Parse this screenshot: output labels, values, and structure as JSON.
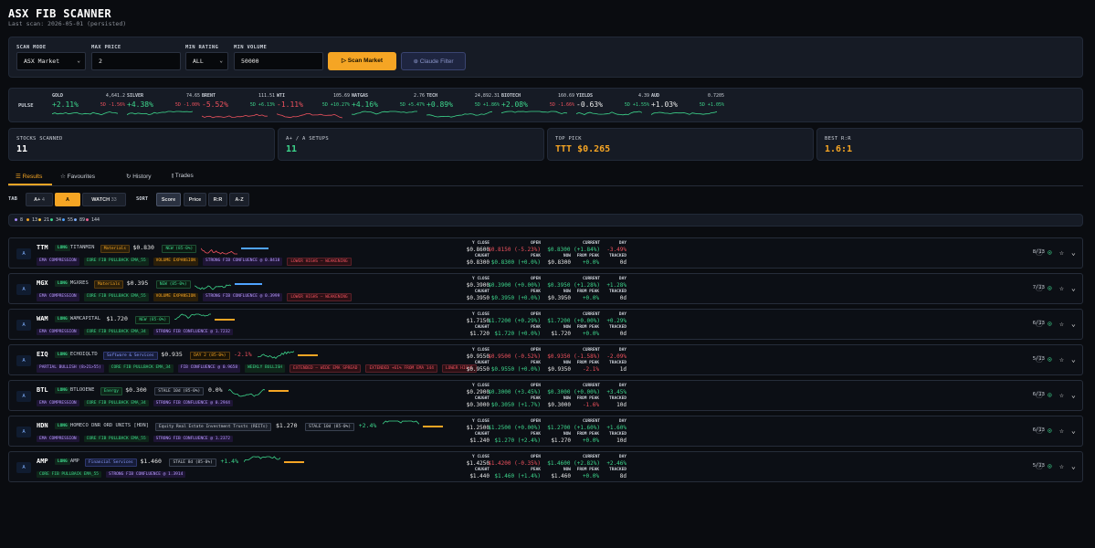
{
  "header": {
    "title": "ASX FIB SCANNER",
    "subtitle": "Last scan: 2026-05-01 (persisted)"
  },
  "controls": {
    "scan_mode_label": "SCAN MODE",
    "scan_mode_value": "ASX Market",
    "max_price_label": "MAX PRICE",
    "max_price_value": "2",
    "min_rating_label": "MIN RATING",
    "min_rating_value": "ALL",
    "min_volume_label": "MIN VOLUME",
    "min_volume_value": "50000",
    "scan_button": "Scan Market",
    "claude_button": "Claude Filter"
  },
  "pulse": {
    "label": "PULSE",
    "items": [
      {
        "name": "GOLD",
        "value": "4,641.2",
        "change": "+2.11%",
        "five_day": "5D -1.56%",
        "dir": "up",
        "fd_dir": "down"
      },
      {
        "name": "SILVER",
        "value": "74.65",
        "change": "+4.38%",
        "five_day": "5D -1.00%",
        "dir": "up",
        "fd_dir": "down"
      },
      {
        "name": "BRENT",
        "value": "111.51",
        "change": "-5.52%",
        "five_day": "5D +6.13%",
        "dir": "down",
        "fd_dir": "up"
      },
      {
        "name": "WTI",
        "value": "105.69",
        "change": "-1.11%",
        "five_day": "5D +10.27%",
        "dir": "down",
        "fd_dir": "up"
      },
      {
        "name": "NATGAS",
        "value": "2.76",
        "change": "+4.16%",
        "five_day": "5D +5.47%",
        "dir": "up",
        "fd_dir": "up"
      },
      {
        "name": "TECH",
        "value": "24,892.31",
        "change": "+0.89%",
        "five_day": "5D +1.86%",
        "dir": "up",
        "fd_dir": "up"
      },
      {
        "name": "BIOTECH",
        "value": "160.69",
        "change": "+2.08%",
        "five_day": "5D -1.66%",
        "dir": "up",
        "fd_dir": "down"
      },
      {
        "name": "YIELDS",
        "value": "4.39",
        "change": "-0.63%",
        "five_day": "5D +1.55%",
        "dir": "flat",
        "fd_dir": "up"
      },
      {
        "name": "AUD",
        "value": "0.7205",
        "change": "+1.03%",
        "five_day": "5D +1.05%",
        "dir": "flat",
        "fd_dir": "up"
      }
    ]
  },
  "stats": {
    "scanned_label": "STOCKS SCANNED",
    "scanned_value": "11",
    "setups_label": "A+ / A SETUPS",
    "setups_value": "11",
    "top_label": "TOP PICK",
    "top_value": "TTT $0.265",
    "rr_label": "BEST R:R",
    "rr_value": "1.6:1"
  },
  "nav_tabs": [
    "Results",
    "Favourites",
    "History",
    "Trades"
  ],
  "filter": {
    "tab_label": "TAB",
    "aplus": "A+",
    "aplus_count": "4",
    "a": "A",
    "watch": "WATCH",
    "watch_count": "33",
    "sort_label": "SORT",
    "sort_options": [
      "Score",
      "Price",
      "R:R",
      "A-Z"
    ]
  },
  "fib_counts": [
    "8",
    "13",
    "21",
    "34",
    "55",
    "89",
    "144"
  ],
  "rows": [
    {
      "grade": "A",
      "symbol": "TTM",
      "side": "LONG",
      "company": "TITANMIN",
      "sector": "Materials",
      "price": "$0.830",
      "badge": "NEW (85-0%)",
      "pct": "",
      "tags": [
        "EMA COMPRESSION",
        "CORE FIB PULLBACK EMA_55",
        "VOLUME EXPANSION",
        "STRONG FIB CONFLUENCE @ 0.8418",
        "LOWER HIGHS — WEAKENING"
      ],
      "yclose": "$0.8600",
      "open": "$0.8150 (-5.23%)",
      "current": "$0.8300 (+1.84%)",
      "day": "-3.49%",
      "caught": "$0.8300",
      "peak": "$0.8300 (+0.0%)",
      "now": "$0.8300",
      "from_peak": "+0.0%",
      "tracked": "0d",
      "score": "8/13"
    },
    {
      "grade": "A",
      "symbol": "MGX",
      "side": "LONG",
      "company": "MGXRES",
      "sector": "Materials",
      "price": "$0.395",
      "badge": "NEW (85-0%)",
      "pct": "",
      "tags": [
        "EMA COMPRESSION",
        "CORE FIB PULLBACK EMA_55",
        "VOLUME EXPANSION",
        "STRONG FIB CONFLUENCE @ 0.3999",
        "LOWER HIGHS — WEAKENING"
      ],
      "yclose": "$0.3900",
      "open": "$0.3900 (+0.00%)",
      "current": "$0.3950 (+1.28%)",
      "day": "+1.28%",
      "caught": "$0.3950",
      "peak": "$0.3950 (+0.0%)",
      "now": "$0.3950",
      "from_peak": "+0.0%",
      "tracked": "0d",
      "score": "7/13"
    },
    {
      "grade": "A",
      "symbol": "WAM",
      "side": "LONG",
      "company": "WAMCAPITAL",
      "sector": "",
      "price": "$1.720",
      "badge": "NEW (85-0%)",
      "pct": "",
      "tags": [
        "EMA COMPRESSION",
        "CORE FIB PULLBACK EMA_34",
        "STRONG FIB CONFLUENCE @ 1.7232"
      ],
      "yclose": "$1.7150",
      "open": "$1.7200 (+0.29%)",
      "current": "$1.7200 (+0.00%)",
      "day": "+0.29%",
      "caught": "$1.720",
      "peak": "$1.720 (+0.0%)",
      "now": "$1.720",
      "from_peak": "+0.0%",
      "tracked": "0d",
      "score": "6/13"
    },
    {
      "grade": "A",
      "symbol": "EIQ",
      "side": "LONG",
      "company": "ECHOIQLTD",
      "sector": "Software & Services",
      "price": "$0.935",
      "badge": "DAY 2 (85-0%)",
      "pct": "-2.1%",
      "tags": [
        "PARTIAL BULLISH (8>21>55)",
        "CORE FIB PULLBACK EMA_34",
        "FIB CONFLUENCE @ 0.9658",
        "WEEKLY BULLISH",
        "EXTENDED — WIDE EMA SPREAD",
        "EXTENDED +61% FROM EMA 144",
        "LOWER HIGHS"
      ],
      "yclose": "$0.9550",
      "open": "$0.9500 (-0.52%)",
      "current": "$0.9350 (-1.58%)",
      "day": "-2.09%",
      "caught": "$0.9550",
      "peak": "$0.9550 (+0.0%)",
      "now": "$0.9350",
      "from_peak": "-2.1%",
      "tracked": "1d",
      "score": "5/13"
    },
    {
      "grade": "A",
      "symbol": "BTL",
      "side": "LONG",
      "company": "BTLOOENE",
      "sector": "Energy",
      "price": "$0.300",
      "badge": "STALE 10d (85-0%)",
      "pct": "0.0%",
      "tags": [
        "EMA COMPRESSION",
        "CORE FIB PULLBACK EMA_34",
        "STRONG FIB CONFLUENCE @ 0.2944"
      ],
      "yclose": "$0.2900",
      "open": "$0.3000 (+3.45%)",
      "current": "$0.3000 (+0.00%)",
      "day": "+3.45%",
      "caught": "$0.3000",
      "peak": "$0.3050 (+1.7%)",
      "now": "$0.3000",
      "from_peak": "-1.6%",
      "tracked": "10d",
      "score": "6/13"
    },
    {
      "grade": "A",
      "symbol": "HDN",
      "side": "LONG",
      "company": "HOMECO DNR ORD UNITS [HDN]",
      "sector": "Equity Real Estate Investment Trusts (REITs)",
      "price": "$1.270",
      "badge": "STALE 10d (85-0%)",
      "pct": "+2.4%",
      "tags": [
        "EMA COMPRESSION",
        "CORE FIB PULLBACK EMA_55",
        "STRONG FIB CONFLUENCE @ 1.2372"
      ],
      "yclose": "$1.2500",
      "open": "$1.2500 (+0.00%)",
      "current": "$1.2700 (+1.60%)",
      "day": "+1.60%",
      "caught": "$1.240",
      "peak": "$1.270 (+2.4%)",
      "now": "$1.270",
      "from_peak": "+0.0%",
      "tracked": "10d",
      "score": "6/13"
    },
    {
      "grade": "A",
      "symbol": "AMP",
      "side": "LONG",
      "company": "AMP",
      "sector": "Financial Services",
      "price": "$1.460",
      "badge": "STALE 8d (85-0%)",
      "pct": "+1.4%",
      "tags": [
        "CORE FIB PULLBACK EMA_55",
        "STRONG FIB CONFLUENCE @ 1.3914"
      ],
      "yclose": "$1.4250",
      "open": "$1.4200 (-0.35%)",
      "current": "$1.4600 (+2.82%)",
      "day": "+2.46%",
      "caught": "$1.440",
      "peak": "$1.460 (+1.4%)",
      "now": "$1.460",
      "from_peak": "+0.0%",
      "tracked": "8d",
      "score": "5/13"
    }
  ],
  "quote_labels": {
    "yclose": "Y CLOSE",
    "open": "OPEN",
    "current": "CURRENT",
    "day": "DAY",
    "caught": "CAUGHT",
    "peak": "PEAK",
    "now": "NOW",
    "from_peak": "FROM PEAK",
    "tracked": "TRACKED"
  }
}
